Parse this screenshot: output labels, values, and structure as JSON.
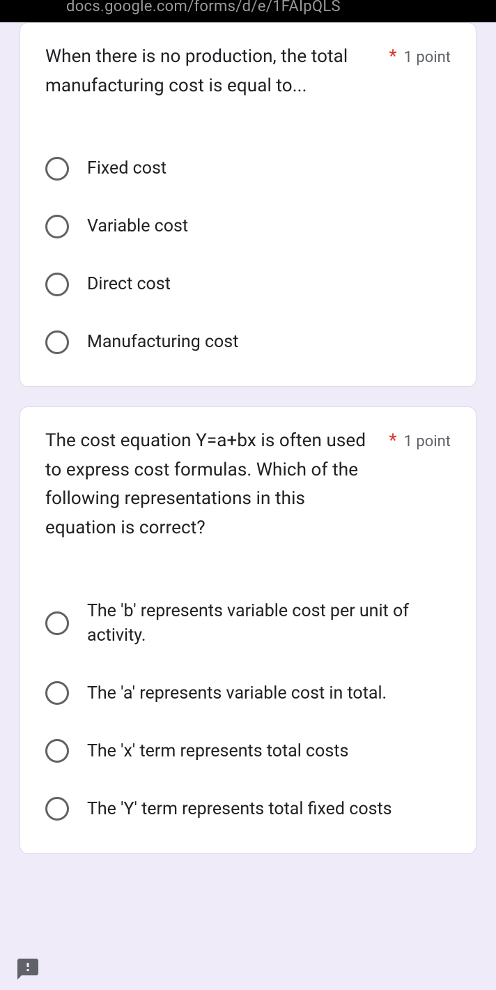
{
  "urlbar": "docs.google.com/forms/d/e/1FAIpQLS",
  "questions": [
    {
      "text": "When there is no production, the total manufacturing cost is equal to...",
      "required_mark": "*",
      "points": "1 point",
      "options": [
        "Fixed cost",
        "Variable cost",
        "Direct cost",
        "Manufacturing cost"
      ]
    },
    {
      "text": "The cost equation Y=a+bx is often used to express cost formulas. Which of the following representations in this equation is correct?",
      "required_mark": "*",
      "points": "1 point",
      "options": [
        "The 'b' represents variable cost per unit of activity.",
        "The 'a' represents variable cost in total.",
        "The 'x' term represents total costs",
        "The 'Y' term represents total fixed costs"
      ]
    }
  ]
}
